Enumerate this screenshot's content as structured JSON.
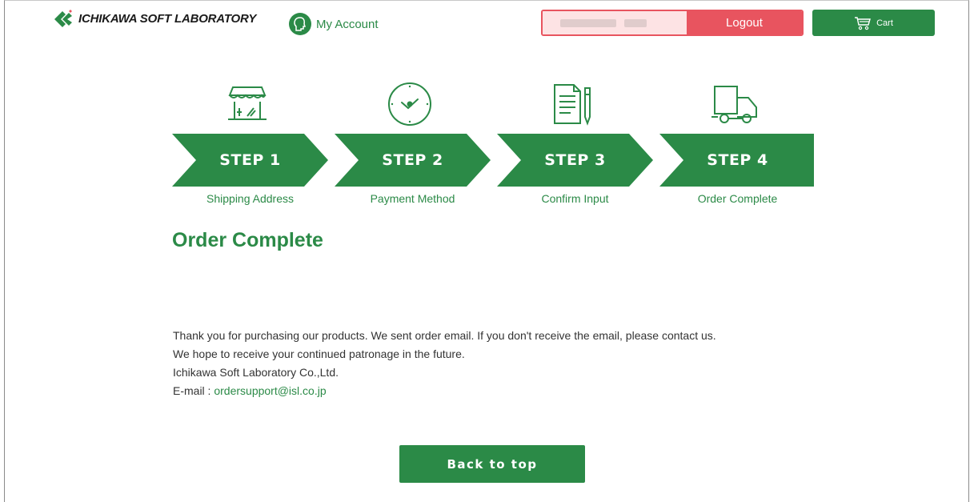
{
  "header": {
    "logo_text": "ICHIKAWA SOFT LABORATORY",
    "account_label": "My Account",
    "logout_label": "Logout",
    "cart_label": "Cart"
  },
  "steps": [
    {
      "number": "STEP 1",
      "label": "Shipping Address",
      "icon": "storefront-icon"
    },
    {
      "number": "STEP 2",
      "label": "Payment Method",
      "icon": "clock-icon"
    },
    {
      "number": "STEP 3",
      "label": "Confirm Input",
      "icon": "document-pen-icon"
    },
    {
      "number": "STEP 4",
      "label": "Order Complete",
      "icon": "delivery-truck-icon"
    }
  ],
  "main": {
    "title": "Order Complete",
    "message_line1": "Thank you for purchasing our products. We sent order email. If you don't receive the email, please contact us.",
    "message_line2": "We hope to receive your continued patronage in the future.",
    "message_line3": "Ichikawa Soft Laboratory Co.,Ltd.",
    "email_prefix": "E-mail : ",
    "email": "ordersupport@isl.co.jp",
    "back_button": "Back to top"
  },
  "colors": {
    "brand_green": "#2b8a47",
    "logout_red": "#e8545f",
    "user_box_bg": "#fde3e4"
  }
}
